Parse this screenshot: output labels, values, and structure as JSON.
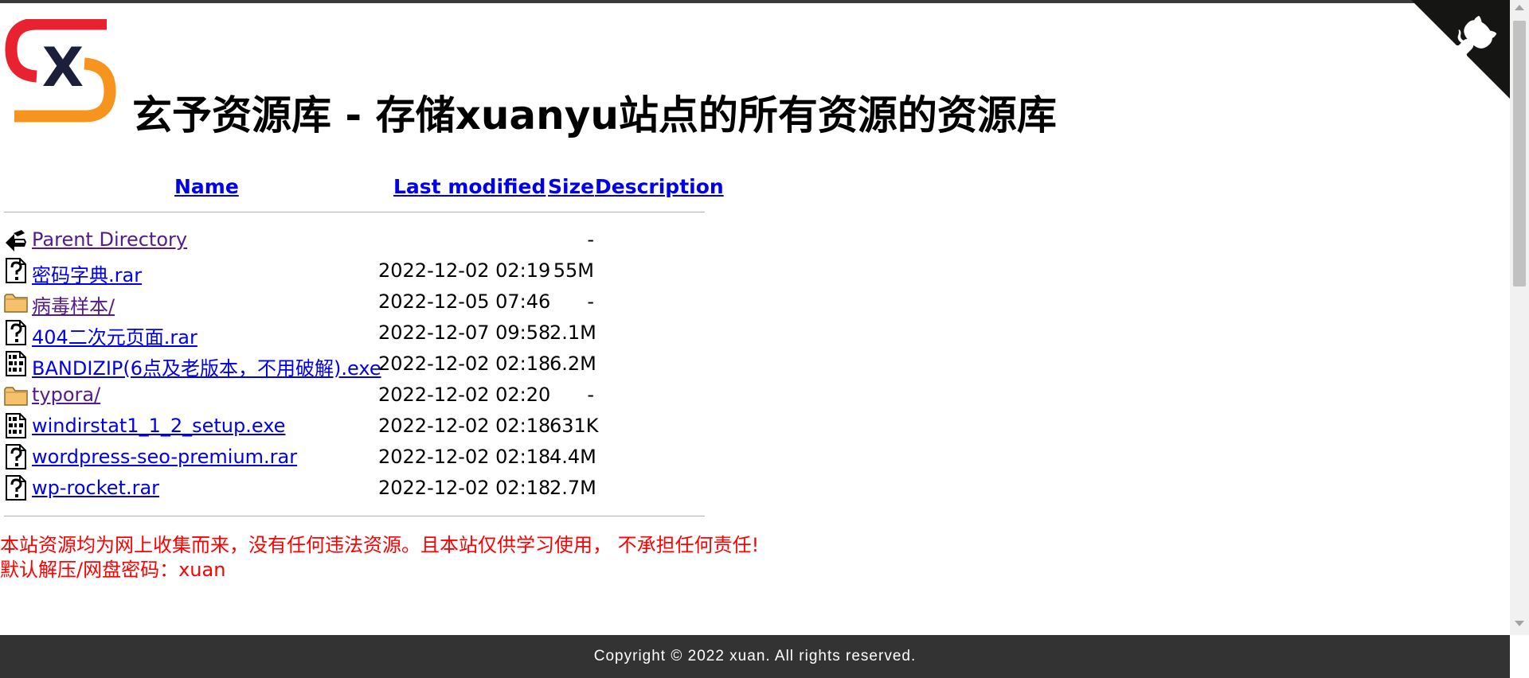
{
  "title": "玄予资源库 - 存储xuanyu站点的所有资源的资源库",
  "logo": {
    "icon": "sx-logo-icon",
    "letter": "X",
    "colors": {
      "red": "#e8232f",
      "orange": "#f7941d",
      "navy": "#1b1f3a"
    }
  },
  "table": {
    "headers": {
      "name": "Name",
      "last_modified": "Last modified",
      "size": "Size",
      "description": "Description"
    },
    "rows": [
      {
        "icon": "back-icon",
        "name": "Parent Directory",
        "date": "",
        "size": "-",
        "visited": true
      },
      {
        "icon": "unknown-file-icon",
        "name": "密码字典.rar",
        "date": "2022-12-02 02:19",
        "size": "55M",
        "visited": false
      },
      {
        "icon": "folder-icon",
        "name": "病毒样本/",
        "date": "2022-12-05 07:46",
        "size": "-",
        "visited": true
      },
      {
        "icon": "unknown-file-icon",
        "name": "404二次元页面.rar",
        "date": "2022-12-07 09:58",
        "size": "2.1M",
        "visited": false
      },
      {
        "icon": "binary-file-icon",
        "name": "BANDIZIP(6点及老版本，不用破解).exe",
        "date": "2022-12-02 02:18",
        "size": "6.2M",
        "visited": false
      },
      {
        "icon": "folder-icon",
        "name": "typora/",
        "date": "2022-12-02 02:20",
        "size": "-",
        "visited": true
      },
      {
        "icon": "binary-file-icon",
        "name": "windirstat1_1_2_setup.exe",
        "date": "2022-12-02 02:18",
        "size": "631K",
        "visited": false
      },
      {
        "icon": "unknown-file-icon",
        "name": "wordpress-seo-premium.rar",
        "date": "2022-12-02 02:18",
        "size": "4.4M",
        "visited": false
      },
      {
        "icon": "unknown-file-icon",
        "name": "wp-rocket.rar",
        "date": "2022-12-02 02:18",
        "size": "2.7M",
        "visited": false
      }
    ]
  },
  "notice": {
    "line1": "本站资源均为网上收集而来，没有任何违法资源。且本站仅供学习使用， 不承担任何责任!",
    "line2": "默认解压/网盘密码：xuan"
  },
  "corner": {
    "icon": "github-octocat-icon",
    "color": "#151513"
  },
  "footer": {
    "text": "Copyright © 2022 xuan. All rights reserved."
  },
  "colors": {
    "link": "#0000ee",
    "visited": "#551a8b",
    "notice": "#ff0000",
    "footer_bg": "#333333"
  }
}
